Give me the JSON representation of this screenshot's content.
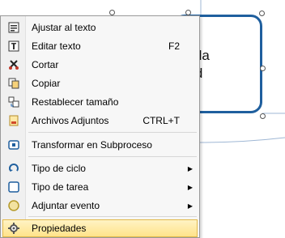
{
  "diagram": {
    "task_text": "de la\ndad",
    "accent_color": "#1f5f9e"
  },
  "context_menu": {
    "highlight_color": "#ffe38a",
    "items": [
      {
        "label": "Ajustar al texto",
        "icon": "fit-to-text-icon",
        "shortcut": ""
      },
      {
        "label": "Editar texto",
        "icon": "edit-text-icon",
        "shortcut": "F2"
      },
      {
        "label": "Cortar",
        "icon": "scissors-icon",
        "shortcut": ""
      },
      {
        "label": "Copiar",
        "icon": "copy-icon",
        "shortcut": ""
      },
      {
        "label": "Restablecer tamaño",
        "icon": "reset-size-icon",
        "shortcut": ""
      },
      {
        "label": "Archivos Adjuntos",
        "icon": "attachment-icon",
        "shortcut": "CTRL+T"
      },
      {
        "label": "Transformar en Subproceso",
        "icon": "subprocess-icon",
        "shortcut": ""
      },
      {
        "label": "Tipo de ciclo",
        "icon": "loop-icon",
        "shortcut": "",
        "submenu": true
      },
      {
        "label": "Tipo de tarea",
        "icon": "task-type-icon",
        "shortcut": "",
        "submenu": true
      },
      {
        "label": "Adjuntar evento",
        "icon": "event-icon",
        "shortcut": "",
        "submenu": true
      },
      {
        "label": "Propiedades",
        "icon": "gear-icon",
        "shortcut": "",
        "highlighted": true
      }
    ]
  }
}
